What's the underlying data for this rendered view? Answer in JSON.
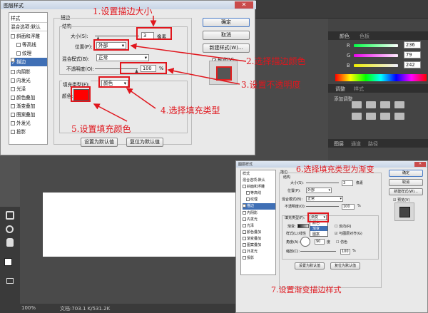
{
  "ps": {
    "panel_tab1": "颜色",
    "panel_tab2": "色板",
    "rgb_labels": [
      "R",
      "G",
      "B"
    ],
    "rgb_values": [
      "236",
      "79",
      "242"
    ],
    "panel2_tab1": "调整",
    "panel2_tab2": "样式",
    "panel2_add_label": "添加调整",
    "panel3_tab1": "图层",
    "panel3_tab2": "通道",
    "panel3_tab3": "路径",
    "status_zoom": "100%",
    "status_doc": "文档:703.1 K/531.2K"
  },
  "dialog": {
    "title": "图层样式",
    "list": [
      "样式",
      "混合选项:默认",
      "斜面和浮雕",
      "等高线",
      "纹理",
      "描边",
      "内阴影",
      "内发光",
      "光泽",
      "颜色叠加",
      "渐变叠加",
      "图案叠加",
      "外发光",
      "投影"
    ],
    "section": "描边",
    "structure": "结构",
    "size_label": "大小(S):",
    "size_value": "3",
    "size_unit": "像素",
    "position_label": "位置(P):",
    "position_value": "外部",
    "blend_label": "混合模式(B):",
    "blend_value": "正常",
    "opacity_label": "不透明度(O):",
    "opacity_value": "100",
    "opacity_unit": "%",
    "fill_type_label": "填充类型(F):",
    "fill_type_value": "颜色",
    "color_label": "颜色:",
    "default_btn": "设置为默认值",
    "reset_btn": "复位为默认值",
    "ok": "确定",
    "cancel": "取消",
    "new_style": "新建样式(W)...",
    "preview": "预览(V)",
    "swatch_color": "#ff0000"
  },
  "annotations": {
    "a1": "1.设置描边大小",
    "a2": "2.选择描边颜色",
    "a3": "3.设置不透明度",
    "a4": "4.选择填充类型",
    "a5": "5.设置填充颜色",
    "a6": "6.选择填充类型为渐变",
    "a7": "7.设置渐变描边样式"
  },
  "dialog2": {
    "title": "图层样式",
    "list": [
      "样式",
      "混合选项:默认",
      "斜面和浮雕",
      "等高线",
      "纹理",
      "描边",
      "内阴影",
      "内发光",
      "光泽",
      "颜色叠加",
      "渐变叠加",
      "图案叠加",
      "外发光",
      "投影"
    ],
    "section": "描边",
    "structure": "结构",
    "size_label": "大小(S):",
    "size_value": "3",
    "size_unit": "像素",
    "position_label": "位置(P):",
    "position_value": "外部",
    "blend_label": "混合模式(B):",
    "blend_value": "正常",
    "opacity_label": "不透明度(O):",
    "opacity_value": "100",
    "opacity_unit": "%",
    "fill_type_label": "填充类型(F):",
    "fill_type_value": "渐变",
    "fill_options": [
      "颜色",
      "渐变",
      "图案"
    ],
    "gradient_label": "渐变:",
    "reverse_label": "反向(R)",
    "style_label": "样式(L):",
    "style_value": "线性",
    "align_label": "与图层对齐(G)",
    "angle_label": "角度(A):",
    "angle_value": "90",
    "angle_unit": "度",
    "dither_label": "仿色",
    "scale_label": "缩放(C):",
    "scale_value": "100",
    "scale_unit": "%",
    "default_btn": "设置为默认值",
    "reset_btn": "复位为默认值",
    "ok": "确定",
    "cancel": "取消",
    "new_style": "新建样式(W)...",
    "preview": "预览(V)"
  }
}
